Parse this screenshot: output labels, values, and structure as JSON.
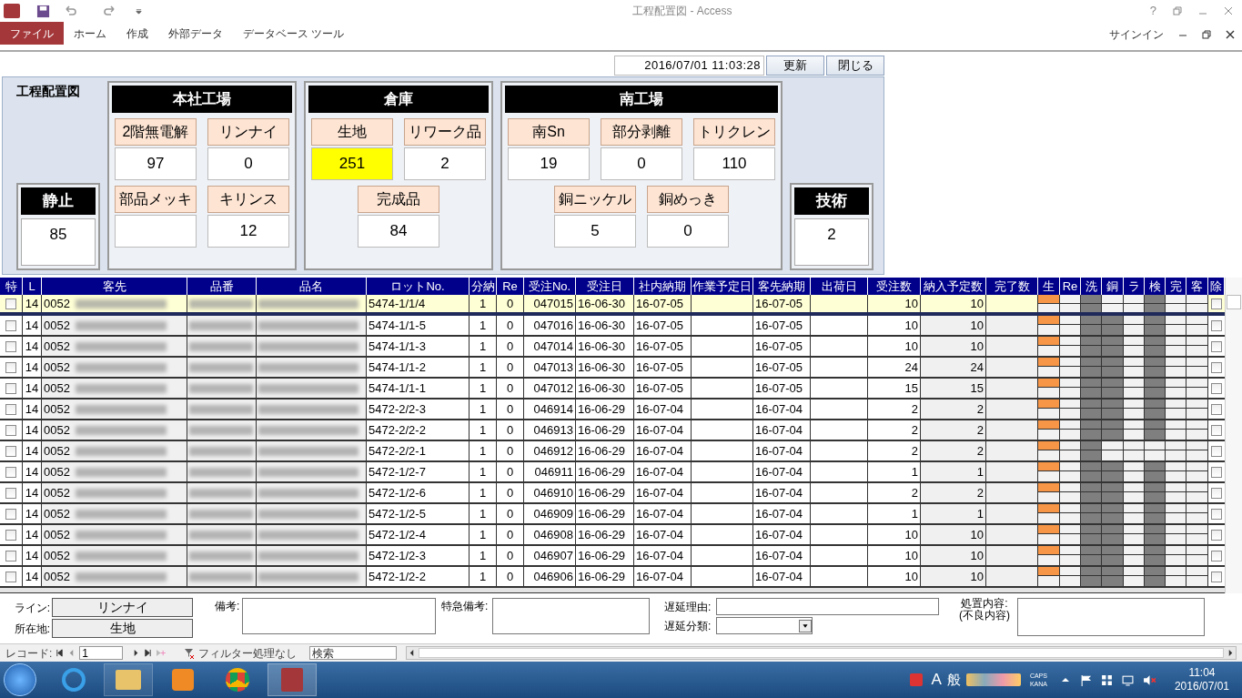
{
  "window": {
    "title": "工程配置図 - Access",
    "help": "?",
    "signin": "サインイン"
  },
  "ribbon_tabs": [
    {
      "label": "ファイル",
      "selected": true
    },
    {
      "label": "ホーム",
      "selected": false
    },
    {
      "label": "作成",
      "selected": false
    },
    {
      "label": "外部データ",
      "selected": false
    },
    {
      "label": "データベース ツール",
      "selected": false
    }
  ],
  "form": {
    "title": "工程配置図",
    "timestamp": "2016/07/01 11:03:28",
    "buttons": [
      "更新",
      "閉じる"
    ],
    "left_box": {
      "label": "静止",
      "value": "85"
    },
    "right_box": {
      "label": "技術",
      "value": "2"
    },
    "groups": [
      {
        "title": "本社工場",
        "rows": [
          [
            {
              "label": "2階無電解",
              "value": "97",
              "highlighted": false
            },
            {
              "label": "リンナイ",
              "value": "0",
              "highlighted": false
            }
          ],
          [
            {
              "label": "部品メッキ",
              "highlighted": false
            },
            {
              "label": "キリンス",
              "value": "12",
              "highlighted": false
            }
          ]
        ]
      },
      {
        "title": "倉庫",
        "rows": [
          [
            {
              "label": "生地",
              "value": "251",
              "highlighted": true
            },
            {
              "label": "リワーク品",
              "value": "2",
              "highlighted": false
            }
          ],
          [
            {
              "label": "完成品",
              "value": "84",
              "highlighted": false
            }
          ]
        ]
      },
      {
        "title": "南工場",
        "rows": [
          [
            {
              "label": "南Sn",
              "value": "19",
              "highlighted": false
            },
            {
              "label": "部分剥離",
              "value": "0",
              "highlighted": false
            },
            {
              "label": "トリクレン",
              "value": "110",
              "highlighted": false
            }
          ],
          [
            {
              "label": "銅ニッケル",
              "value": "5",
              "highlighted": false
            },
            {
              "label": "銅めっき",
              "value": "0",
              "highlighted": false
            }
          ]
        ]
      }
    ]
  },
  "table": {
    "columns": [
      "特",
      "L",
      "客先",
      "品番",
      "品名",
      "ロットNo.",
      "分納",
      "Re",
      "受注No.",
      "受注日",
      "社内納期",
      "作業予定日",
      "客先納期",
      "出荷日",
      "受注数",
      "納入予定数",
      "完了数",
      "生",
      "Re",
      "洗",
      "銅",
      "ラ",
      "検",
      "完",
      "客",
      "除"
    ],
    "rows": [
      {
        "selected": true,
        "checked": false,
        "line": "14",
        "customer_code": "0052",
        "lot": "5474-1/1/4",
        "split": "1",
        "re": "0",
        "order_no": "047015",
        "order_date": "16-06-30",
        "internal_due": "16-07-05",
        "customer_due": "16-07-05",
        "order_qty": "10",
        "planned_qty": "10",
        "process": [
          {
            "active": true,
            "done": false
          },
          {
            "active": false,
            "done": false
          },
          {
            "active": false,
            "done": true
          },
          {
            "active": false,
            "done": false
          },
          {
            "active": false,
            "done": false
          },
          {
            "active": false,
            "done": true
          },
          {
            "active": false,
            "done": false
          },
          {
            "active": false,
            "done": false
          }
        ],
        "remove_checked": false
      },
      {
        "selected": false,
        "checked": false,
        "line": "14",
        "customer_code": "0052",
        "lot": "5474-1/1-5",
        "split": "1",
        "re": "0",
        "order_no": "047016",
        "order_date": "16-06-30",
        "internal_due": "16-07-05",
        "customer_due": "16-07-05",
        "order_qty": "10",
        "planned_qty": "10",
        "process": [
          {
            "active": true,
            "done": false
          },
          {
            "active": false,
            "done": false
          },
          {
            "active": false,
            "done": true
          },
          {
            "active": false,
            "done": true
          },
          {
            "active": false,
            "done": false
          },
          {
            "active": false,
            "done": true
          },
          {
            "active": false,
            "done": false
          },
          {
            "active": false,
            "done": false
          }
        ],
        "remove_checked": false
      },
      {
        "selected": false,
        "checked": false,
        "line": "14",
        "customer_code": "0052",
        "lot": "5474-1/1-3",
        "split": "1",
        "re": "0",
        "order_no": "047014",
        "order_date": "16-06-30",
        "internal_due": "16-07-05",
        "customer_due": "16-07-05",
        "order_qty": "10",
        "planned_qty": "10",
        "process": [
          {
            "active": true,
            "done": false
          },
          {
            "active": false,
            "done": false
          },
          {
            "active": false,
            "done": true
          },
          {
            "active": false,
            "done": true
          },
          {
            "active": false,
            "done": false
          },
          {
            "active": false,
            "done": true
          },
          {
            "active": false,
            "done": false
          },
          {
            "active": false,
            "done": false
          }
        ],
        "remove_checked": false
      },
      {
        "selected": false,
        "checked": false,
        "line": "14",
        "customer_code": "0052",
        "lot": "5474-1/1-2",
        "split": "1",
        "re": "0",
        "order_no": "047013",
        "order_date": "16-06-30",
        "internal_due": "16-07-05",
        "customer_due": "16-07-05",
        "order_qty": "24",
        "planned_qty": "24",
        "process": [
          {
            "active": true,
            "done": false
          },
          {
            "active": false,
            "done": false
          },
          {
            "active": false,
            "done": true
          },
          {
            "active": false,
            "done": true
          },
          {
            "active": false,
            "done": false
          },
          {
            "active": false,
            "done": true
          },
          {
            "active": false,
            "done": false
          },
          {
            "active": false,
            "done": false
          }
        ],
        "remove_checked": false
      },
      {
        "selected": false,
        "checked": false,
        "line": "14",
        "customer_code": "0052",
        "lot": "5474-1/1-1",
        "split": "1",
        "re": "0",
        "order_no": "047012",
        "order_date": "16-06-30",
        "internal_due": "16-07-05",
        "customer_due": "16-07-05",
        "order_qty": "15",
        "planned_qty": "15",
        "process": [
          {
            "active": true,
            "done": false
          },
          {
            "active": false,
            "done": false
          },
          {
            "active": false,
            "done": true
          },
          {
            "active": false,
            "done": true
          },
          {
            "active": false,
            "done": false
          },
          {
            "active": false,
            "done": true
          },
          {
            "active": false,
            "done": false
          },
          {
            "active": false,
            "done": false
          }
        ],
        "remove_checked": false
      },
      {
        "selected": false,
        "checked": false,
        "line": "14",
        "customer_code": "0052",
        "lot": "5472-2/2-3",
        "split": "1",
        "re": "0",
        "order_no": "046914",
        "order_date": "16-06-29",
        "internal_due": "16-07-04",
        "customer_due": "16-07-04",
        "order_qty": "2",
        "planned_qty": "2",
        "process": [
          {
            "active": true,
            "done": false
          },
          {
            "active": false,
            "done": false
          },
          {
            "active": false,
            "done": true
          },
          {
            "active": false,
            "done": true
          },
          {
            "active": false,
            "done": false
          },
          {
            "active": false,
            "done": true
          },
          {
            "active": false,
            "done": false
          },
          {
            "active": false,
            "done": false
          }
        ],
        "remove_checked": false
      },
      {
        "selected": false,
        "checked": false,
        "line": "14",
        "customer_code": "0052",
        "lot": "5472-2/2-2",
        "split": "1",
        "re": "0",
        "order_no": "046913",
        "order_date": "16-06-29",
        "internal_due": "16-07-04",
        "customer_due": "16-07-04",
        "order_qty": "2",
        "planned_qty": "2",
        "process": [
          {
            "active": true,
            "done": false
          },
          {
            "active": false,
            "done": false
          },
          {
            "active": false,
            "done": true
          },
          {
            "active": false,
            "done": true
          },
          {
            "active": false,
            "done": false
          },
          {
            "active": false,
            "done": true
          },
          {
            "active": false,
            "done": false
          },
          {
            "active": false,
            "done": false
          }
        ],
        "remove_checked": false
      },
      {
        "selected": false,
        "checked": false,
        "line": "14",
        "customer_code": "0052",
        "lot": "5472-2/2-1",
        "split": "1",
        "re": "0",
        "order_no": "046912",
        "order_date": "16-06-29",
        "internal_due": "16-07-04",
        "customer_due": "16-07-04",
        "order_qty": "2",
        "planned_qty": "2",
        "process": [
          {
            "active": true,
            "done": false
          },
          {
            "active": false,
            "done": false
          },
          {
            "active": false,
            "done": true
          },
          {
            "active": false,
            "done": false
          },
          {
            "active": false,
            "done": false
          },
          {
            "active": false,
            "done": false
          },
          {
            "active": false,
            "done": false
          },
          {
            "active": false,
            "done": false
          }
        ],
        "remove_checked": false
      },
      {
        "selected": false,
        "checked": false,
        "line": "14",
        "customer_code": "0052",
        "lot": "5472-1/2-7",
        "split": "1",
        "re": "0",
        "order_no": "046911",
        "order_date": "16-06-29",
        "internal_due": "16-07-04",
        "customer_due": "16-07-04",
        "order_qty": "1",
        "planned_qty": "1",
        "process": [
          {
            "active": true,
            "done": false
          },
          {
            "active": false,
            "done": false
          },
          {
            "active": false,
            "done": true
          },
          {
            "active": false,
            "done": true
          },
          {
            "active": false,
            "done": false
          },
          {
            "active": false,
            "done": true
          },
          {
            "active": false,
            "done": false
          },
          {
            "active": false,
            "done": false
          }
        ],
        "remove_checked": false
      },
      {
        "selected": false,
        "checked": false,
        "line": "14",
        "customer_code": "0052",
        "lot": "5472-1/2-6",
        "split": "1",
        "re": "0",
        "order_no": "046910",
        "order_date": "16-06-29",
        "internal_due": "16-07-04",
        "customer_due": "16-07-04",
        "order_qty": "2",
        "planned_qty": "2",
        "process": [
          {
            "active": true,
            "done": false
          },
          {
            "active": false,
            "done": false
          },
          {
            "active": false,
            "done": true
          },
          {
            "active": false,
            "done": true
          },
          {
            "active": false,
            "done": false
          },
          {
            "active": false,
            "done": true
          },
          {
            "active": false,
            "done": false
          },
          {
            "active": false,
            "done": false
          }
        ],
        "remove_checked": false
      },
      {
        "selected": false,
        "checked": false,
        "line": "14",
        "customer_code": "0052",
        "lot": "5472-1/2-5",
        "split": "1",
        "re": "0",
        "order_no": "046909",
        "order_date": "16-06-29",
        "internal_due": "16-07-04",
        "customer_due": "16-07-04",
        "order_qty": "1",
        "planned_qty": "1",
        "process": [
          {
            "active": true,
            "done": false
          },
          {
            "active": false,
            "done": false
          },
          {
            "active": false,
            "done": true
          },
          {
            "active": false,
            "done": true
          },
          {
            "active": false,
            "done": false
          },
          {
            "active": false,
            "done": true
          },
          {
            "active": false,
            "done": false
          },
          {
            "active": false,
            "done": false
          }
        ],
        "remove_checked": false
      },
      {
        "selected": false,
        "checked": false,
        "line": "14",
        "customer_code": "0052",
        "lot": "5472-1/2-4",
        "split": "1",
        "re": "0",
        "order_no": "046908",
        "order_date": "16-06-29",
        "internal_due": "16-07-04",
        "customer_due": "16-07-04",
        "order_qty": "10",
        "planned_qty": "10",
        "process": [
          {
            "active": true,
            "done": false
          },
          {
            "active": false,
            "done": false
          },
          {
            "active": false,
            "done": true
          },
          {
            "active": false,
            "done": true
          },
          {
            "active": false,
            "done": false
          },
          {
            "active": false,
            "done": true
          },
          {
            "active": false,
            "done": false
          },
          {
            "active": false,
            "done": false
          }
        ],
        "remove_checked": false
      },
      {
        "selected": false,
        "checked": false,
        "line": "14",
        "customer_code": "0052",
        "lot": "5472-1/2-3",
        "split": "1",
        "re": "0",
        "order_no": "046907",
        "order_date": "16-06-29",
        "internal_due": "16-07-04",
        "customer_due": "16-07-04",
        "order_qty": "10",
        "planned_qty": "10",
        "process": [
          {
            "active": true,
            "done": false
          },
          {
            "active": false,
            "done": false
          },
          {
            "active": false,
            "done": true
          },
          {
            "active": false,
            "done": true
          },
          {
            "active": false,
            "done": false
          },
          {
            "active": false,
            "done": true
          },
          {
            "active": false,
            "done": false
          },
          {
            "active": false,
            "done": false
          }
        ],
        "remove_checked": false
      },
      {
        "selected": false,
        "checked": false,
        "line": "14",
        "customer_code": "0052",
        "lot": "5472-1/2-2",
        "split": "1",
        "re": "0",
        "order_no": "046906",
        "order_date": "16-06-29",
        "internal_due": "16-07-04",
        "customer_due": "16-07-04",
        "order_qty": "10",
        "planned_qty": "10",
        "process": [
          {
            "active": true,
            "done": false
          },
          {
            "active": false,
            "done": false
          },
          {
            "active": false,
            "done": true
          },
          {
            "active": false,
            "done": true
          },
          {
            "active": false,
            "done": false
          },
          {
            "active": false,
            "done": true
          },
          {
            "active": false,
            "done": false
          },
          {
            "active": false,
            "done": false
          }
        ],
        "remove_checked": false
      }
    ]
  },
  "details": {
    "line_label": "ライン:",
    "line_value": "リンナイ",
    "location_label": "所在地:",
    "location_value": "生地",
    "remarks_label": "備考:",
    "urgent_label": "特急備考:",
    "delay_reason_label": "遅延理由:",
    "delay_class_label": "遅延分類:",
    "action_label": "処置内容:\n(不良内容)"
  },
  "record_nav": {
    "label": "レコード:",
    "current": "1",
    "filter": "フィルター処理なし",
    "search_placeholder": "検索"
  },
  "taskbar": {
    "ime_mode": "A",
    "ime_dict": "般",
    "caps": "CAPS",
    "kana": "KANA",
    "time": "11:04",
    "date": "2016/07/01"
  }
}
